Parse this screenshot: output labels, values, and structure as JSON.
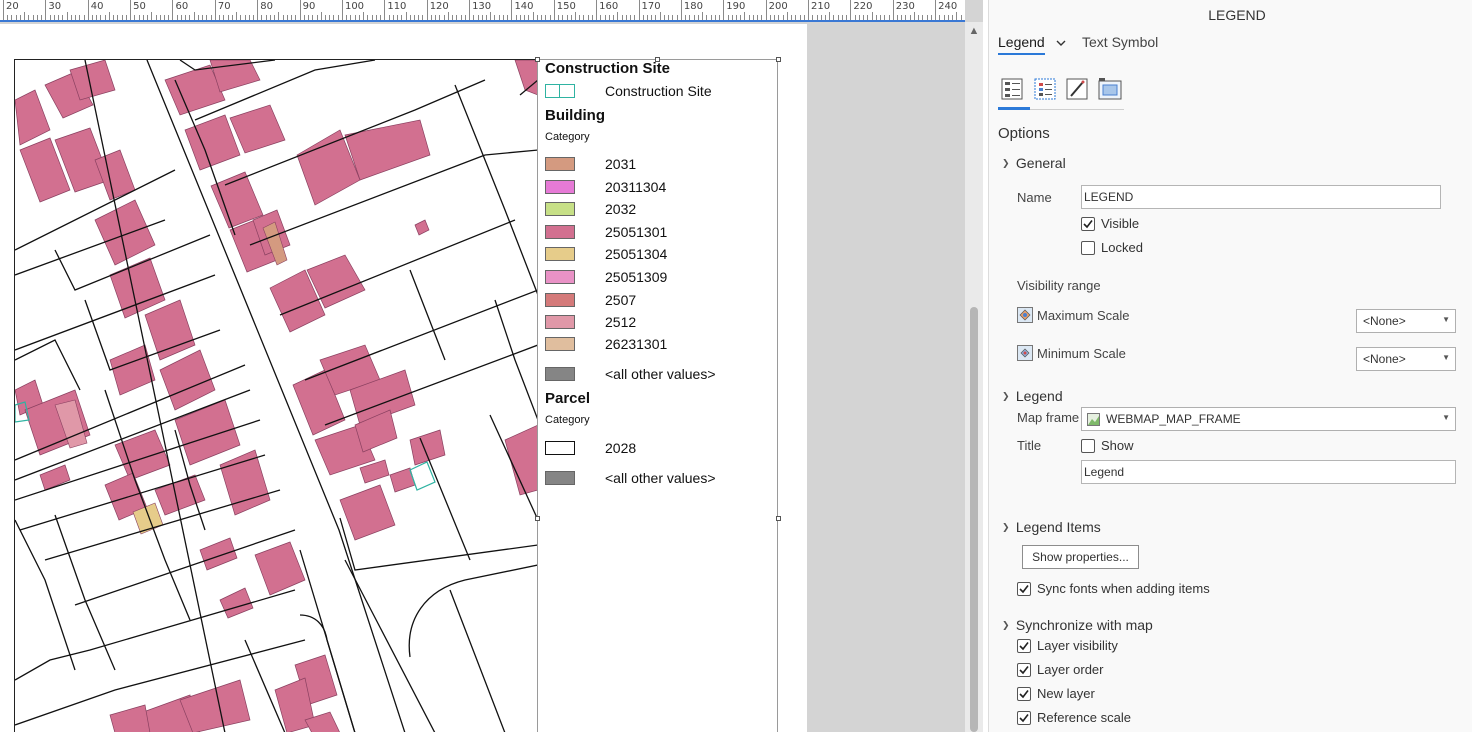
{
  "ruler": {
    "labels": [
      "20",
      "30",
      "40",
      "50",
      "60",
      "70",
      "80",
      "90",
      "100",
      "110",
      "120",
      "130",
      "140",
      "150",
      "160",
      "170",
      "180",
      "190",
      "200",
      "210",
      "220",
      "230",
      "240"
    ]
  },
  "legend": {
    "groups": [
      {
        "heading": "Construction Site",
        "subheading": "",
        "items": [
          {
            "label": "Construction Site",
            "color": "#ffffff",
            "border": "#2fb3a2"
          }
        ]
      },
      {
        "heading": "Building",
        "subheading": "Category",
        "items": [
          {
            "label": "2031",
            "color": "#d49a80"
          },
          {
            "label": "20311304",
            "color": "#e67ad6"
          },
          {
            "label": "2032",
            "color": "#c7e087"
          },
          {
            "label": "25051301",
            "color": "#d27090"
          },
          {
            "label": "25051304",
            "color": "#e6cc8a"
          },
          {
            "label": "25051309",
            "color": "#e992c6"
          },
          {
            "label": "2507",
            "color": "#d47a7a"
          },
          {
            "label": "2512",
            "color": "#e098a8"
          },
          {
            "label": "26231301",
            "color": "#e0be9e"
          },
          {
            "label": "<all other values>",
            "color": "#858585"
          }
        ]
      },
      {
        "heading": "Parcel",
        "subheading": "Category",
        "items": [
          {
            "label": "2028",
            "color": "#ffffff",
            "border": "#111111"
          },
          {
            "label": "<all other values>",
            "color": "#858585"
          }
        ]
      }
    ]
  },
  "pane": {
    "title": "LEGEND",
    "tabs": {
      "active": "Legend",
      "other": "Text Symbol"
    },
    "subtab_icons": [
      "legend-properties-icon",
      "arrangement-icon",
      "symbol-icon",
      "display-icon"
    ],
    "options_heading": "Options",
    "general": {
      "heading": "General",
      "name_label": "Name",
      "name_value": "LEGEND",
      "visible_label": "Visible",
      "visible": true,
      "locked_label": "Locked",
      "locked": false,
      "visibility_range_label": "Visibility range",
      "max_scale_label": "Maximum Scale",
      "max_scale_value": "<None>",
      "min_scale_label": "Minimum Scale",
      "min_scale_value": "<None>"
    },
    "legend_section": {
      "heading": "Legend",
      "map_frame_label": "Map frame",
      "map_frame_value": "WEBMAP_MAP_FRAME",
      "title_label": "Title",
      "show_label": "Show",
      "show": false,
      "title_value": "Legend"
    },
    "legend_items": {
      "heading": "Legend Items",
      "show_properties_label": "Show properties...",
      "sync_fonts_label": "Sync fonts when adding items",
      "sync_fonts": true
    },
    "sync_map": {
      "heading": "Synchronize with map",
      "items": [
        {
          "label": "Layer visibility",
          "checked": true
        },
        {
          "label": "Layer order",
          "checked": true
        },
        {
          "label": "New layer",
          "checked": true
        },
        {
          "label": "Reference scale",
          "checked": true
        }
      ]
    }
  },
  "colors": {
    "accent": "#2b79d8",
    "building_fill": "#d27090",
    "building_stroke": "#8a4060",
    "construction_outline": "#2fb3a2"
  }
}
